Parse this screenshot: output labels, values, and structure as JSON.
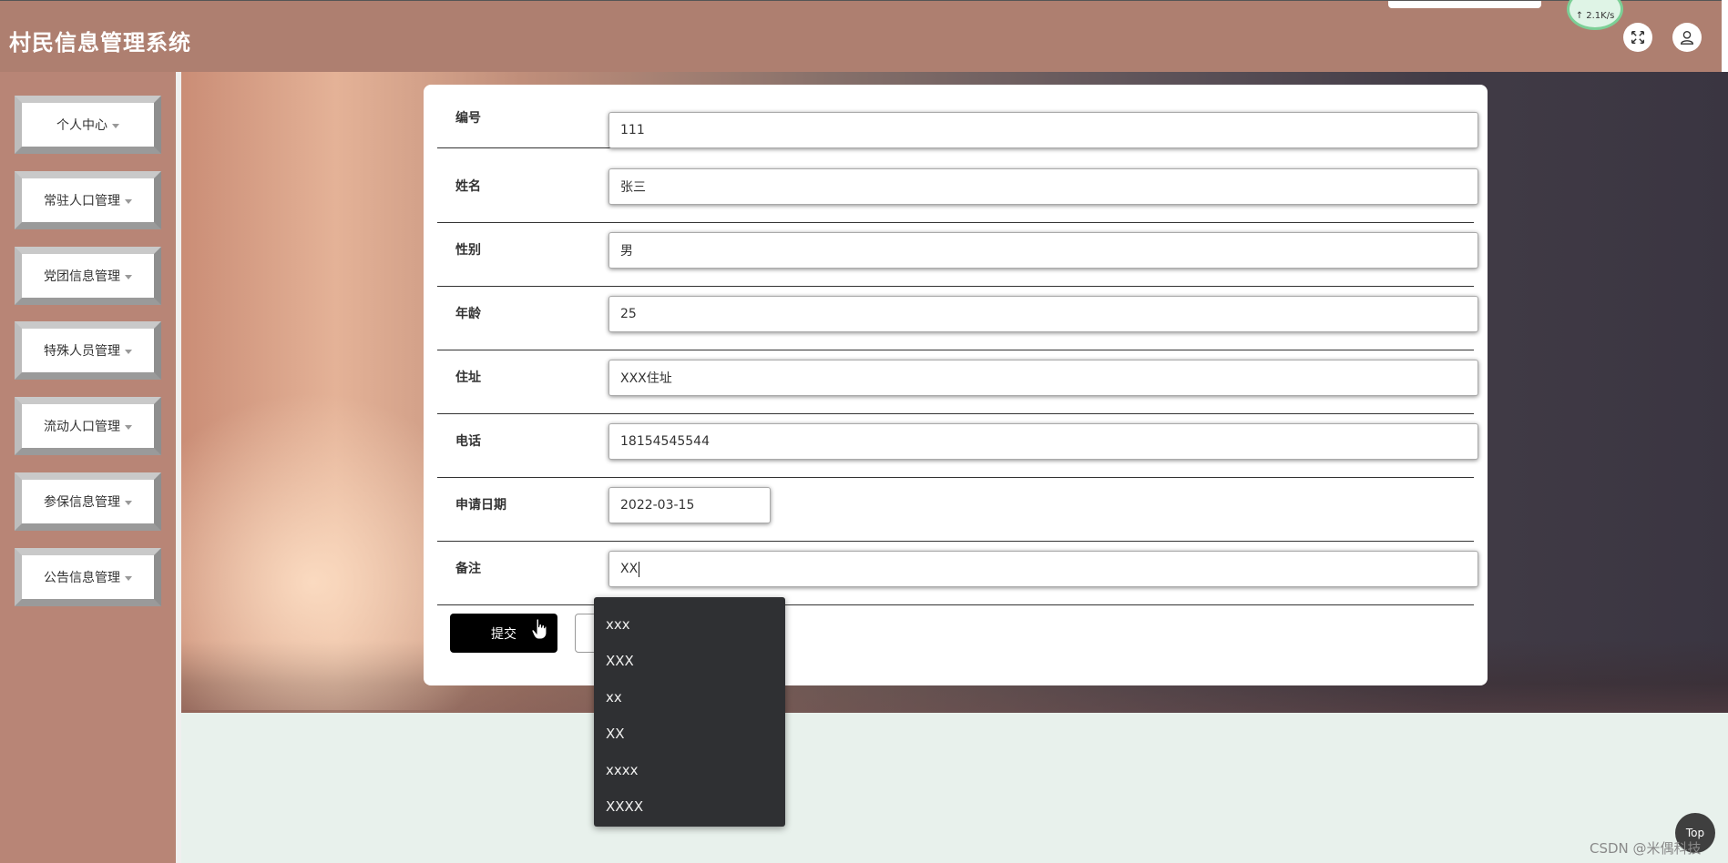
{
  "header": {
    "title": "村民信息管理系统",
    "fullscreen_icon": "expand-icon",
    "user_icon": "user-icon",
    "net_speed": "↑ 2.1K/s"
  },
  "sidebar": {
    "items": [
      {
        "label": "个人中心"
      },
      {
        "label": "常驻人口管理"
      },
      {
        "label": "党团信息管理"
      },
      {
        "label": "特殊人员管理"
      },
      {
        "label": "流动人口管理"
      },
      {
        "label": "参保信息管理"
      },
      {
        "label": "公告信息管理"
      }
    ]
  },
  "form": {
    "fields": [
      {
        "label": "编号",
        "value": "111"
      },
      {
        "label": "姓名",
        "value": "张三"
      },
      {
        "label": "性别",
        "value": "男"
      },
      {
        "label": "年龄",
        "value": "25"
      },
      {
        "label": "住址",
        "value": "XXX住址"
      },
      {
        "label": "电话",
        "value": "18154545544"
      },
      {
        "label": "申请日期",
        "value": "2022-03-15"
      },
      {
        "label": "备注",
        "value": "XX"
      }
    ],
    "submit_label": "提交"
  },
  "autocomplete": {
    "options": [
      "xxx",
      "XXX",
      "xx",
      "XX",
      "xxxx",
      "XXXX"
    ]
  },
  "footer": {
    "top_label": "Top",
    "watermark": "CSDN @米偶科技"
  }
}
